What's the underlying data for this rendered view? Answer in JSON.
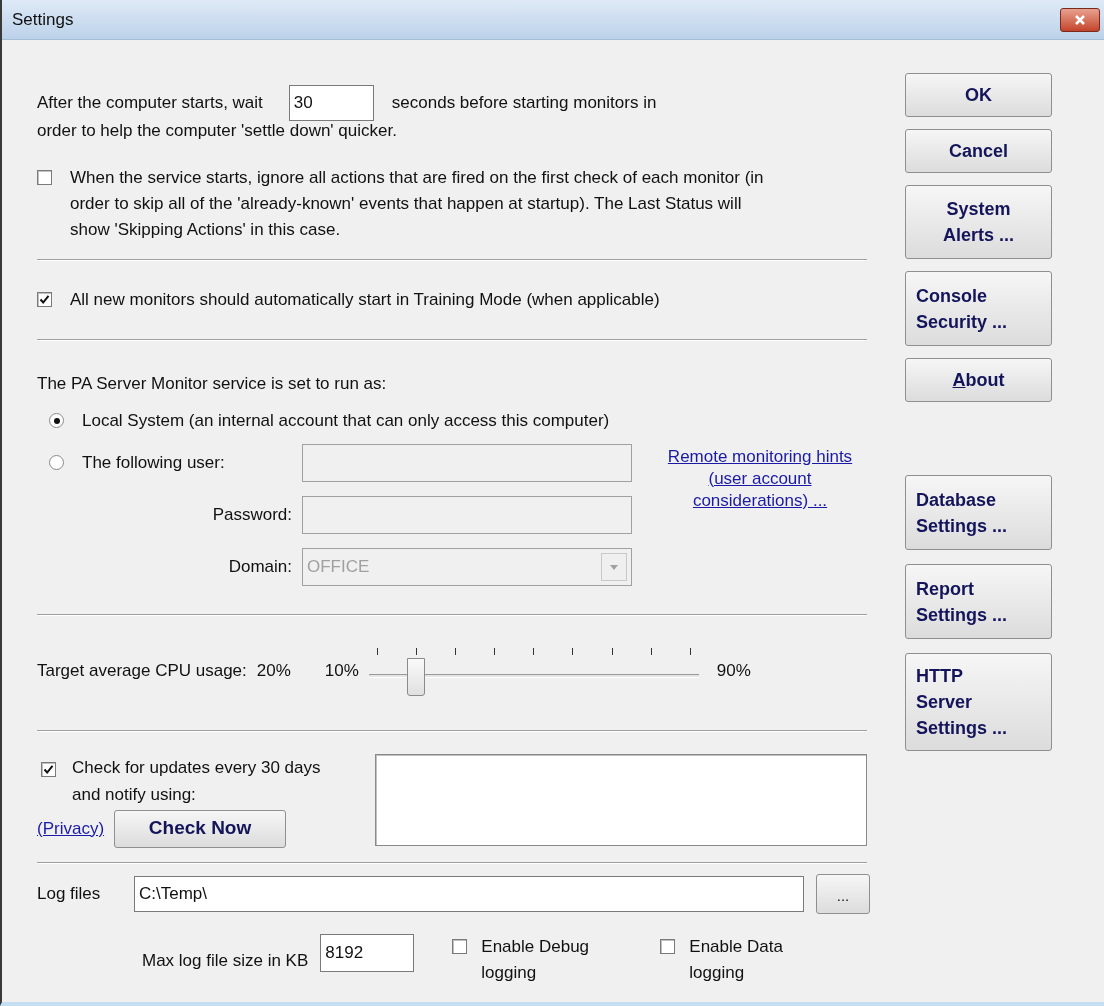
{
  "window": {
    "title": "Settings"
  },
  "startup_delay": {
    "label_before": "After the computer starts, wait",
    "value": "30",
    "label_after": "seconds before starting monitors in",
    "label_line2": "order to help the computer 'settle down' quicker."
  },
  "skip_actions": {
    "checked": false,
    "label": "When the service starts, ignore all actions that are fired on the first check of each monitor (in order to skip all of the 'already-known' events that happen at startup). The Last Status will show 'Skipping Actions' in this case."
  },
  "training_mode": {
    "checked": true,
    "label": "All new monitors should automatically start in Training Mode (when applicable)"
  },
  "service_account": {
    "heading": "The PA Server Monitor service is set to run as:",
    "options": [
      {
        "label": "Local System (an internal account that can only access this computer)",
        "selected": true
      },
      {
        "label": "The following user:",
        "selected": false
      }
    ],
    "fields_disabled": true,
    "password_label": "Password:",
    "domain_label": "Domain:",
    "domain_value": "OFFICE",
    "hints_link": [
      "Remote monitoring hints",
      "(user account",
      "considerations) ..."
    ]
  },
  "cpu": {
    "label": "Target average CPU usage:",
    "reading": "20%",
    "min_label": "10%",
    "max_label": "90%",
    "level": 0.125
  },
  "updates": {
    "checked": true,
    "label": "Check for updates every 30 days and notify using:",
    "privacy_link": "(Privacy)",
    "check_button": "Check Now"
  },
  "logging": {
    "label": "Log files",
    "path": "C:\\Temp\\",
    "browse_button": "...",
    "max_size_label": "Max log file size in KB",
    "max_size": "8192",
    "options": [
      {
        "label": "Enable Debug logging",
        "checked": false
      },
      {
        "label": "Enable Data logging",
        "checked": false
      }
    ]
  },
  "buttons": [
    {
      "lines": [
        "OK"
      ]
    },
    {
      "lines": [
        "Cancel"
      ]
    },
    {
      "lines": [
        "System",
        "Alerts ..."
      ]
    },
    {
      "lines": [
        "Console",
        "Security ..."
      ]
    },
    {
      "access_key": "A",
      "lines": [
        "bout"
      ]
    }
  ],
  "settings_buttons": [
    {
      "lines": [
        "Database",
        "Settings ..."
      ]
    },
    {
      "lines": [
        "Report",
        "Settings ..."
      ]
    },
    {
      "lines": [
        "HTTP",
        "Server",
        "Settings ..."
      ]
    }
  ]
}
